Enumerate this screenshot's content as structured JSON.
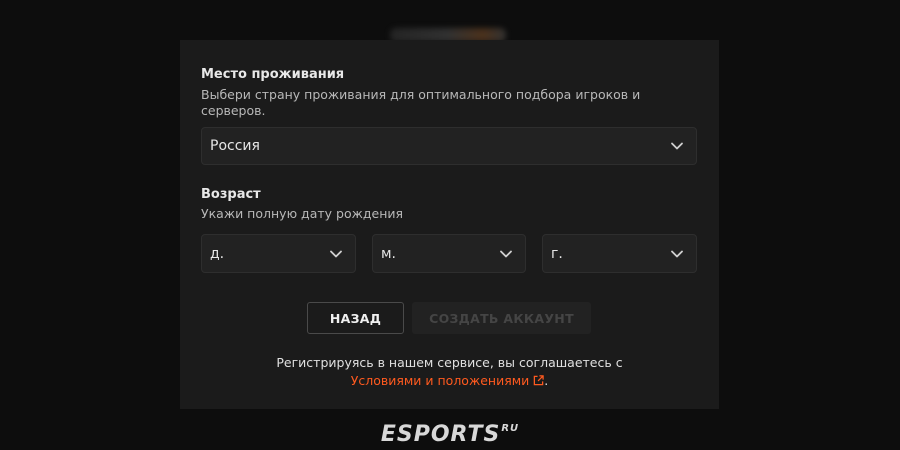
{
  "residence": {
    "title": "Место проживания",
    "description": "Выбери страну проживания для оптимального подбора игроков и серверов.",
    "country_value": "Россия"
  },
  "age": {
    "title": "Возраст",
    "description": "Укажи полную дату рождения",
    "day_value": "д.",
    "month_value": "м.",
    "year_value": "г."
  },
  "buttons": {
    "back_label": "НАЗАД",
    "create_label": "СОЗДАТЬ АККАУНТ"
  },
  "terms": {
    "text": "Регистрируясь в нашем сервисе, вы соглашаетесь с",
    "link_text": "Условиями и положениями",
    "suffix": "."
  },
  "footer": {
    "logo_text": "ESPORTS",
    "logo_suffix": "RU"
  },
  "colors": {
    "accent": "#ff5a1f",
    "panel": "#1b1b1b",
    "background": "#0d0d0d"
  },
  "icons": {
    "dropdown": "chevron-down-icon",
    "external": "external-link-icon"
  }
}
